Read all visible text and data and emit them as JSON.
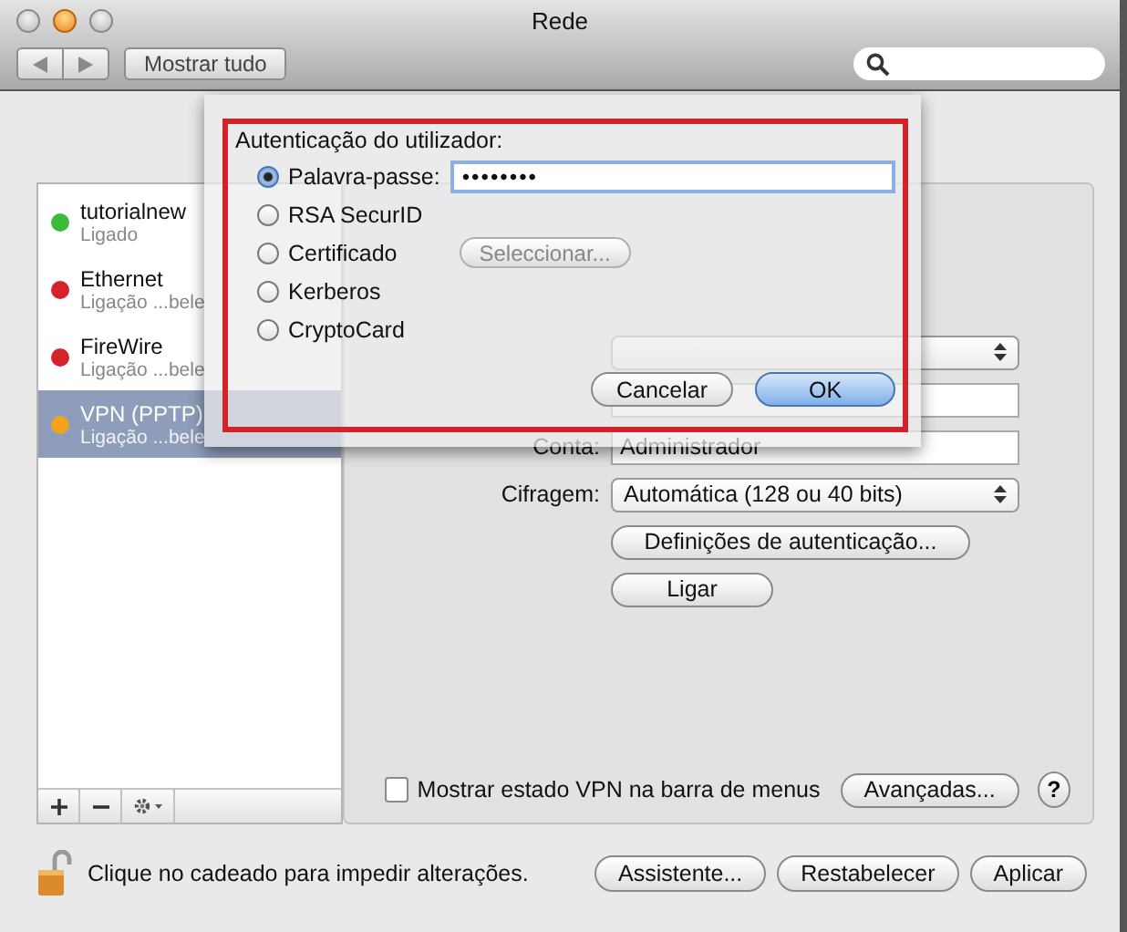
{
  "window": {
    "title": "Rede"
  },
  "toolbar": {
    "show_all": "Mostrar tudo"
  },
  "services": [
    {
      "name": "tutorialnew",
      "status": "Ligado",
      "color": "#3dbb3a",
      "selected": false
    },
    {
      "name": "Ethernet",
      "status": "Ligação ...bele",
      "color": "#d4232b",
      "selected": false
    },
    {
      "name": "FireWire",
      "status": "Ligação ...bele",
      "color": "#d4232b",
      "selected": false
    },
    {
      "name": "VPN (PPTP)",
      "status": "Ligação ...bele",
      "color": "#f2a21d",
      "selected": true
    }
  ],
  "detail": {
    "account_label": "Conta:",
    "account_value": "Administrador",
    "encryption_label": "Cifragem:",
    "encryption_value": "Automática (128 ou 40 bits)",
    "buttons": [
      "Definições de autenticação...",
      "Ligar"
    ],
    "show_vpn_status": {
      "label": "Mostrar estado VPN na barra de menus",
      "checked": false
    },
    "advanced": "Avançadas...",
    "help": "?"
  },
  "lock_text": "Clique no cadeado para impedir alterações.",
  "footer_buttons": [
    "Assistente...",
    "Restabelecer",
    "Aplicar"
  ],
  "sheet": {
    "heading": "Autenticação do utilizador:",
    "options": [
      {
        "label": "Palavra-passe:",
        "selected": true,
        "kind": "password"
      },
      {
        "label": "RSA SecurID",
        "selected": false,
        "kind": "plain"
      },
      {
        "label": "Certificado",
        "selected": false,
        "kind": "select"
      },
      {
        "label": "Kerberos",
        "selected": false,
        "kind": "plain"
      },
      {
        "label": "CryptoCard",
        "selected": false,
        "kind": "plain"
      }
    ],
    "password": "••••••••",
    "select_button": {
      "label": "Seleccionar...",
      "disabled": true
    },
    "cancel": "Cancelar",
    "ok": "OK"
  }
}
